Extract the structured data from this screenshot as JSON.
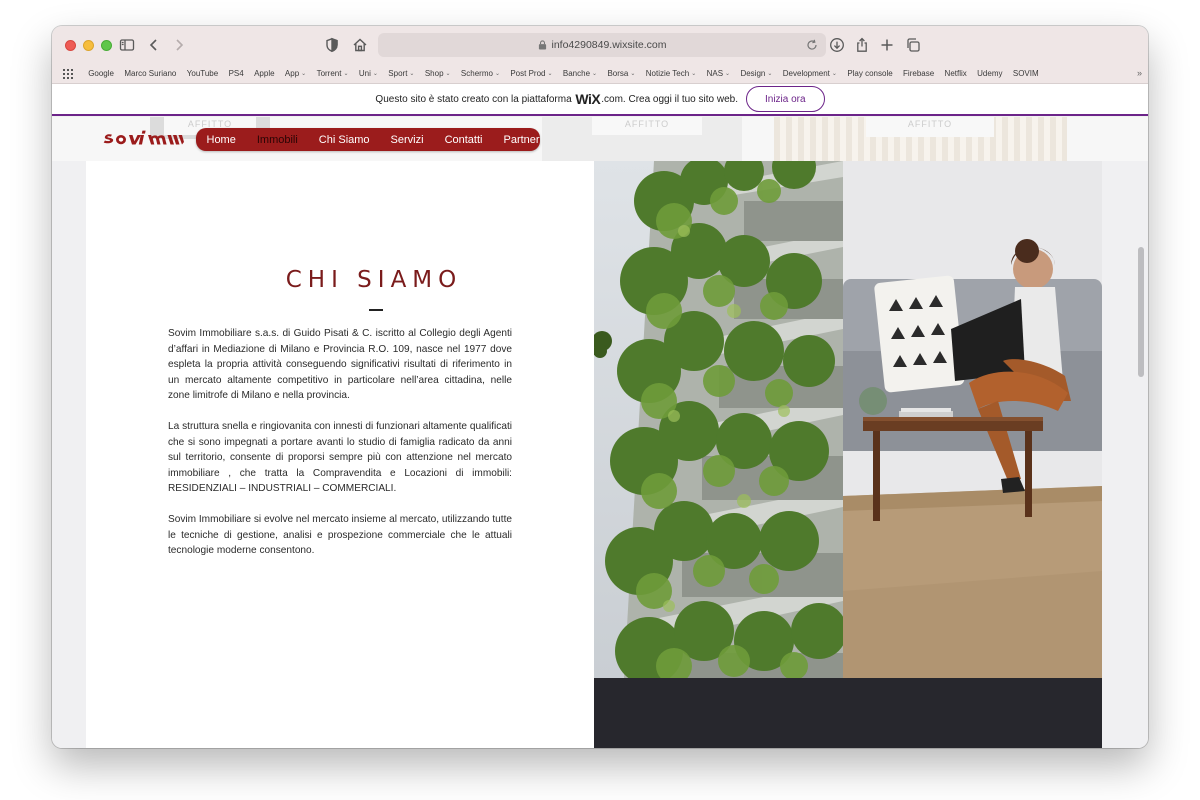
{
  "browser": {
    "url": "info4290849.wixsite.com",
    "bookmarks": [
      {
        "label": "Google",
        "menu": false
      },
      {
        "label": "Marco Suriano",
        "menu": false
      },
      {
        "label": "YouTube",
        "menu": false
      },
      {
        "label": "PS4",
        "menu": false
      },
      {
        "label": "Apple",
        "menu": false
      },
      {
        "label": "App",
        "menu": true
      },
      {
        "label": "Torrent",
        "menu": true
      },
      {
        "label": "Uni",
        "menu": true
      },
      {
        "label": "Sport",
        "menu": true
      },
      {
        "label": "Shop",
        "menu": true
      },
      {
        "label": "Schermo",
        "menu": true
      },
      {
        "label": "Post Prod",
        "menu": true
      },
      {
        "label": "Banche",
        "menu": true
      },
      {
        "label": "Borsa",
        "menu": true
      },
      {
        "label": "Notizie Tech",
        "menu": true
      },
      {
        "label": "NAS",
        "menu": true
      },
      {
        "label": "Design",
        "menu": true
      },
      {
        "label": "Development",
        "menu": true
      },
      {
        "label": "Play console",
        "menu": false
      },
      {
        "label": "Firebase",
        "menu": false
      },
      {
        "label": "Netflix",
        "menu": false
      },
      {
        "label": "Udemy",
        "menu": false
      },
      {
        "label": "SOVIM",
        "menu": false
      }
    ]
  },
  "wix_banner": {
    "text_before": "Questo sito è stato creato con la piattaforma",
    "logo": "WiX",
    "text_after": ".com. Crea oggi il tuo sito web.",
    "cta": "Inizia ora"
  },
  "ghost": {
    "label": "AFFITTO"
  },
  "site": {
    "logo_text": "sovim",
    "brand_color": "#9b1c1c",
    "nav": [
      {
        "label": "Home",
        "active": false
      },
      {
        "label": "Immobili",
        "active": true
      },
      {
        "label": "Chi Siamo",
        "active": false
      },
      {
        "label": "Servizi",
        "active": false
      },
      {
        "label": "Contatti",
        "active": false
      },
      {
        "label": "Partner",
        "active": false
      }
    ]
  },
  "chi_siamo": {
    "title": "CHI SIAMO",
    "paragraphs": [
      "Sovim Immobiliare s.a.s. di Guido Pisati & C. iscritto al Collegio degli Agenti d’affari in Mediazione di Milano e Provincia R.O. 109, nasce nel 1977 dove espleta la propria attività conseguendo significativi risultati di riferimento in un mercato altamente competitivo in particolare nell’area cittadina, nelle zone limitrofe di Milano e nella provincia.",
      "La struttura snella e ringiovanita con innesti di funzionari altamente qualificati che si sono impegnati a portare avanti lo studio di famiglia radicato da anni sul territorio, consente di proporsi sempre più con attenzione nel mercato immobiliare , che tratta la Compravendita e Locazioni di immobili: RESIDENZIALI – INDUSTRIALI – COMMERCIALI.",
      "Sovim Immobiliare si evolve nel mercato insieme al mercato, utilizzando tutte le tecniche di gestione, analisi e prospezione commerciale che le attuali tecnologie moderne consentono."
    ]
  }
}
